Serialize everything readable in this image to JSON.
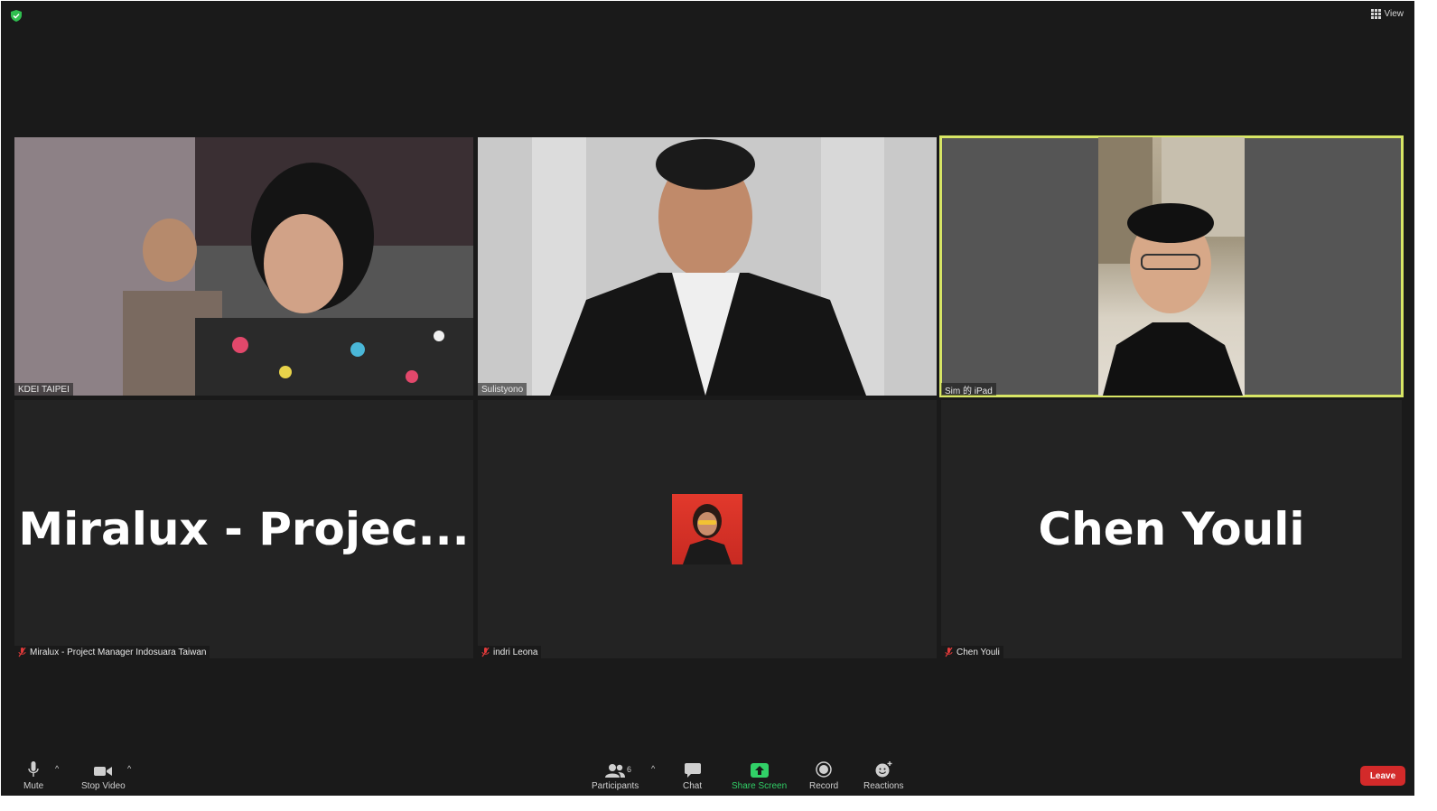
{
  "header": {
    "view_label": "View",
    "security_icon": "shield-check-icon",
    "view_icon": "grid-icon"
  },
  "tiles": [
    {
      "name": "KDEI TAIPEI",
      "type": "video"
    },
    {
      "name": "Sulistyono",
      "type": "video"
    },
    {
      "name": "Sim 的 iPad",
      "type": "video",
      "active_speaker": true
    },
    {
      "name": "Miralux - Project Manager Indosuara Taiwan",
      "display_name": "Miralux - Projec...",
      "type": "name",
      "muted": true
    },
    {
      "name": "indri Leona",
      "type": "avatar",
      "muted": true
    },
    {
      "name": "Chen Youli",
      "display_name": "Chen Youli",
      "type": "name",
      "muted": true
    }
  ],
  "toolbar": {
    "mute_label": "Mute",
    "stop_video_label": "Stop Video",
    "participants_label": "Participants",
    "participants_count": "6",
    "chat_label": "Chat",
    "share_screen_label": "Share Screen",
    "record_label": "Record",
    "reactions_label": "Reactions",
    "leave_label": "Leave",
    "caret": "^"
  },
  "colors": {
    "background": "#1a1a1a",
    "tile": "#232323",
    "active_speaker_border": "#d7e565",
    "share_green": "#31d067",
    "leave_red": "#d32a2a",
    "muted_red": "#e03a3a"
  }
}
